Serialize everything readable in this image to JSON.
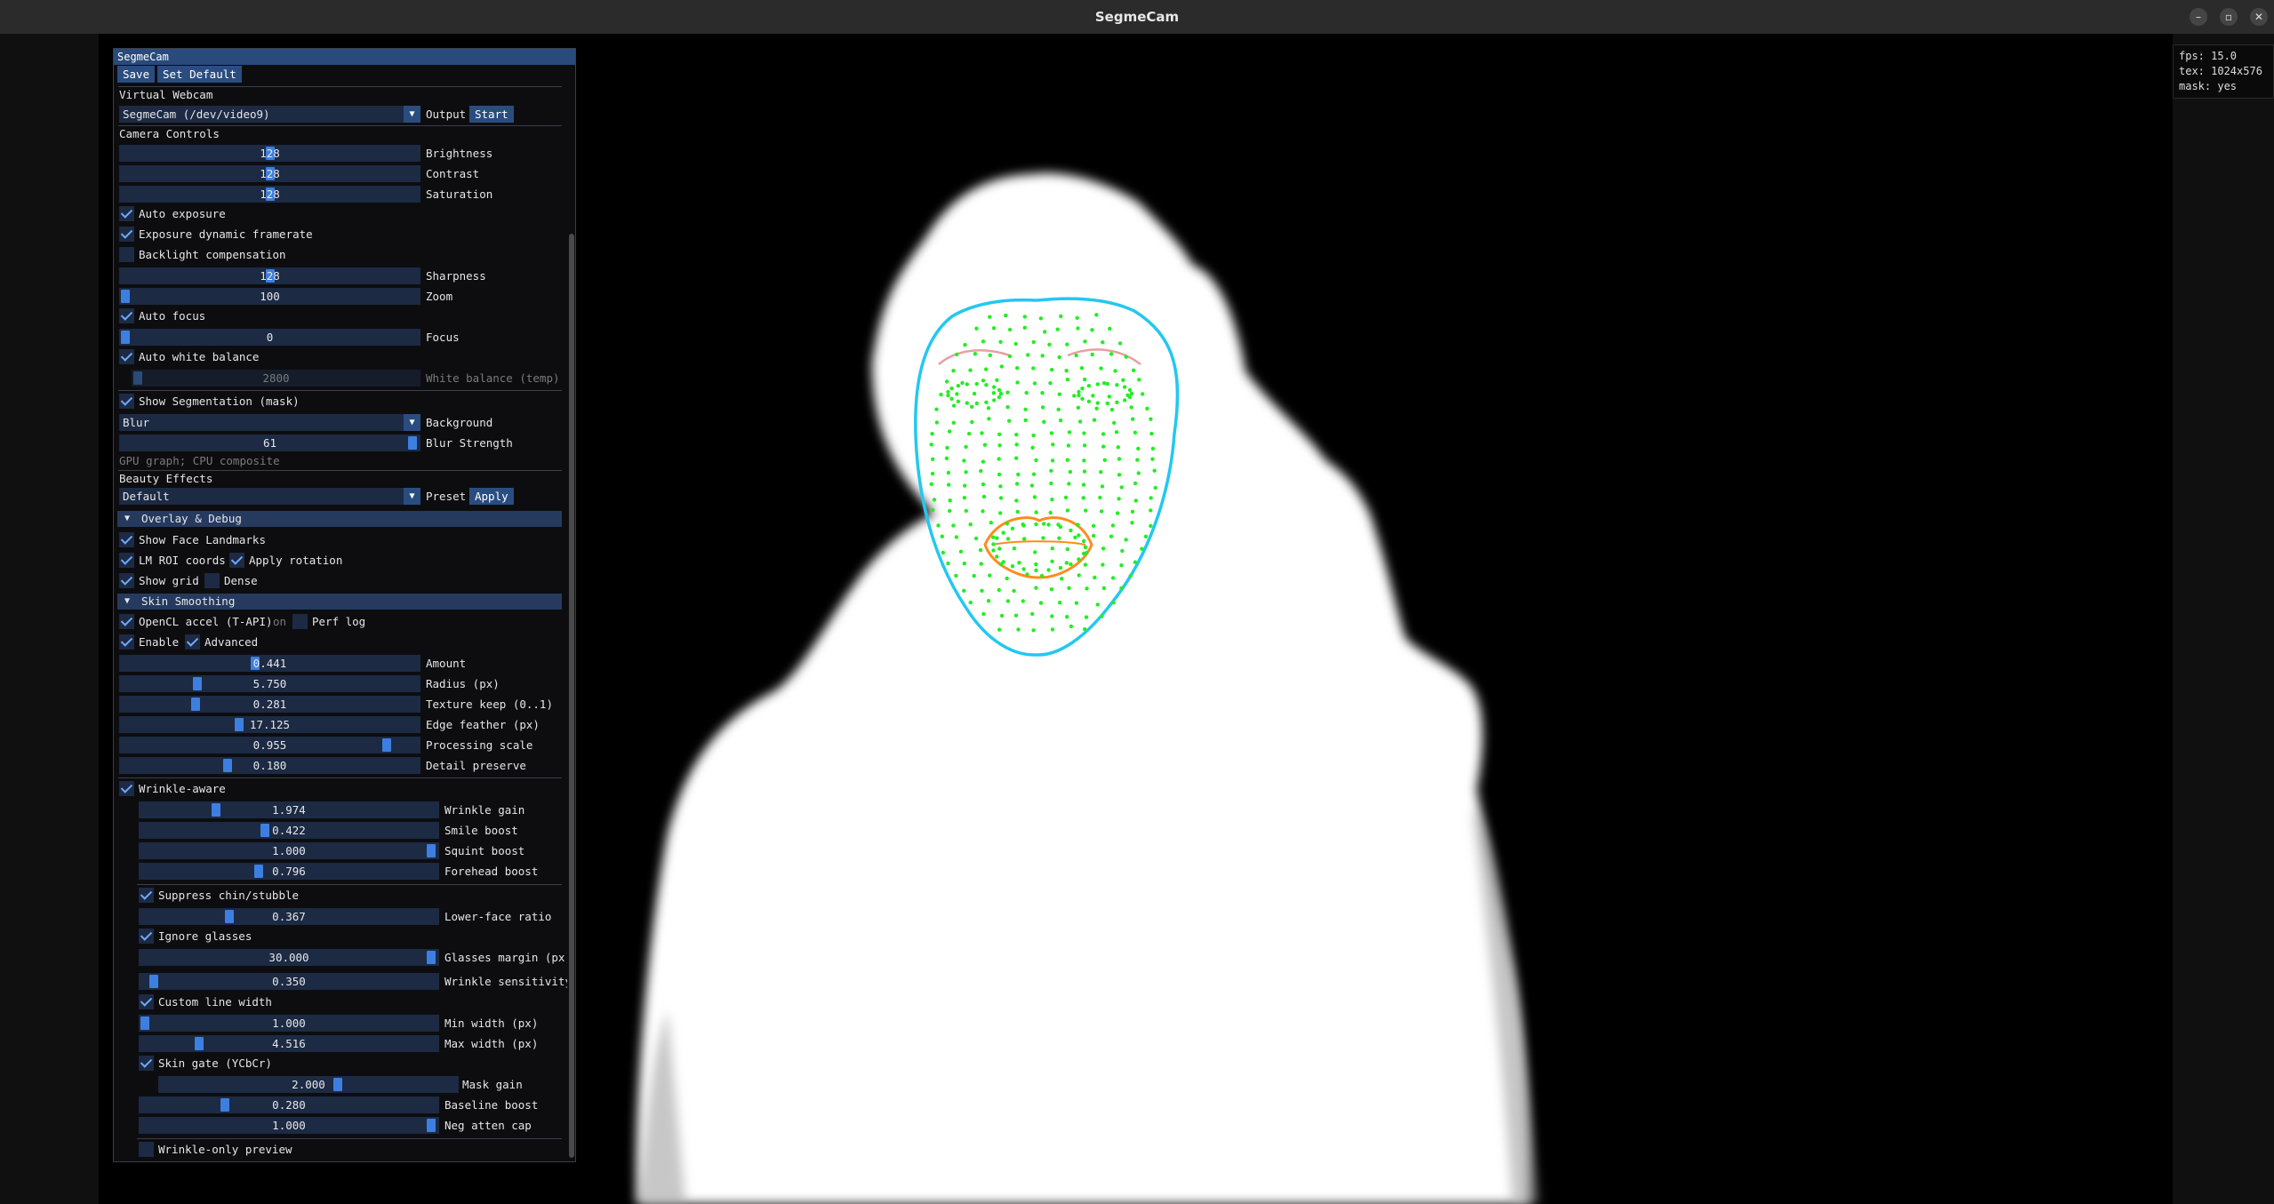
{
  "window": {
    "title": "SegmeCam",
    "buttons": {
      "minimize": "–",
      "maximize": "▫",
      "close": "✕"
    }
  },
  "stats": [
    "fps: 15.0",
    "tex: 1024x576",
    "mask: yes"
  ],
  "panel": {
    "title": "SegmeCam",
    "save": "Save",
    "set_default": "Set Default",
    "virtual_webcam": {
      "section": "Virtual Webcam",
      "device": "SegmeCam (/dev/video9)",
      "output_label": "Output",
      "start": "Start"
    },
    "camera": {
      "section": "Camera Controls",
      "brightness": {
        "label": "Brightness",
        "value": "128"
      },
      "contrast": {
        "label": "Contrast",
        "value": "128"
      },
      "saturation": {
        "label": "Saturation",
        "value": "128"
      },
      "auto_exposure": "Auto exposure",
      "exposure_dynamic": "Exposure dynamic framerate",
      "backlight": "Backlight compensation",
      "sharpness": {
        "label": "Sharpness",
        "value": "128"
      },
      "zoom": {
        "label": "Zoom",
        "value": "100"
      },
      "auto_focus": "Auto focus",
      "focus": {
        "label": "Focus",
        "value": "0"
      },
      "auto_wb": "Auto white balance",
      "wb_temp": {
        "label": "White balance (temp)",
        "value": "2800"
      }
    },
    "segmentation": {
      "show": "Show Segmentation (mask)",
      "background": {
        "label": "Background",
        "value": "Blur"
      },
      "blur_strength": {
        "label": "Blur Strength",
        "value": "61"
      },
      "note": "GPU graph; CPU composite"
    },
    "beauty": {
      "section": "Beauty Effects",
      "preset": {
        "label": "Preset",
        "value": "Default"
      },
      "apply": "Apply"
    },
    "overlay": {
      "header": "Overlay & Debug",
      "show_landmarks": "Show Face Landmarks",
      "lm_roi": "LM ROI coords",
      "apply_rotation": "Apply rotation",
      "show_grid": "Show grid",
      "dense": "Dense"
    },
    "skin": {
      "header": "Skin Smoothing",
      "opencl": "OpenCL accel (T-API)",
      "opencl_status": "on",
      "perf_log": "Perf log",
      "enable": "Enable",
      "advanced": "Advanced",
      "amount": {
        "label": "Amount",
        "value": "0.441"
      },
      "radius": {
        "label": "Radius (px)",
        "value": "5.750"
      },
      "texture_keep": {
        "label": "Texture keep (0..1)",
        "value": "0.281"
      },
      "edge_feather": {
        "label": "Edge feather (px)",
        "value": "17.125"
      },
      "processing_scale": {
        "label": "Processing scale",
        "value": "0.955"
      },
      "detail_preserve": {
        "label": "Detail preserve",
        "value": "0.180"
      },
      "wrinkle_aware": "Wrinkle-aware",
      "wrinkle_gain": {
        "label": "Wrinkle gain",
        "value": "1.974"
      },
      "smile_boost": {
        "label": "Smile boost",
        "value": "0.422"
      },
      "squint_boost": {
        "label": "Squint boost",
        "value": "1.000"
      },
      "forehead_boost": {
        "label": "Forehead boost",
        "value": "0.796"
      },
      "suppress_chin": "Suppress chin/stubble",
      "lower_face": {
        "label": "Lower-face ratio",
        "value": "0.367"
      },
      "ignore_glasses": "Ignore glasses",
      "glasses_margin": {
        "label": "Glasses margin (px)",
        "value": "30.000"
      },
      "wrinkle_sens": {
        "label": "Wrinkle sensitivity",
        "value": "0.350"
      },
      "custom_line": "Custom line width",
      "min_width": {
        "label": "Min width (px)",
        "value": "1.000"
      },
      "max_width": {
        "label": "Max width (px)",
        "value": "4.516"
      },
      "skin_gate": "Skin gate (YCbCr)",
      "mask_gain": {
        "label": "Mask gain",
        "value": "2.000"
      },
      "baseline_boost": {
        "label": "Baseline boost",
        "value": "0.280"
      },
      "neg_atten": {
        "label": "Neg atten cap",
        "value": "1.000"
      },
      "wrinkle_preview": "Wrinkle-only preview"
    }
  },
  "colors": {
    "title_bg": "#294a7a",
    "button": "#2a4d80",
    "frame": "#1c2a44",
    "grab": "#3d7fe0",
    "face_contour": "#22c8f0",
    "landmarks": "#22ee22",
    "lips": "#ff8c1a",
    "brows": "#e8a0a0"
  }
}
